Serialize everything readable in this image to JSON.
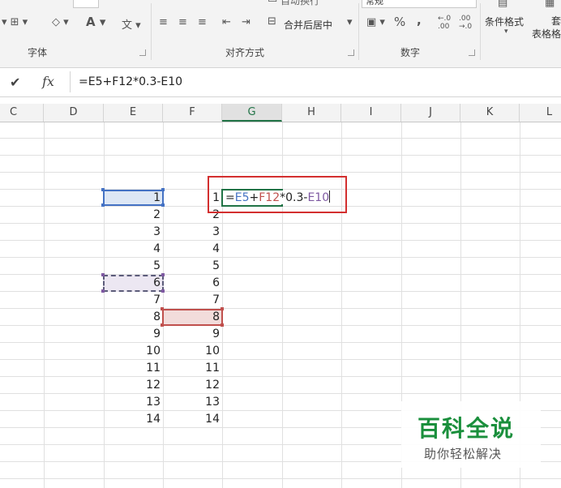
{
  "ribbon": {
    "font_group_label": "字体",
    "align_group_label": "对齐方式",
    "number_group_label": "数字",
    "merge_center_label": "合并后居中",
    "percent_symbol": "%",
    "comma_symbol": ",",
    "cond_format_label": "条件格式",
    "table_format_label": "套用\n表格格式",
    "wrap_text_label": "自动换行",
    "number_format_value": "常规",
    "increase_decimal_label": "←.0\n.00",
    "decrease_decimal_label": ".00\n→.0",
    "font_color_label": "A",
    "phonetic_label": "文"
  },
  "formula_bar": {
    "cancel_symbol": "✔",
    "fx_symbol": "fx",
    "formula": "=E5+F12*0.3-E10"
  },
  "columns": [
    "C",
    "D",
    "E",
    "F",
    "G",
    "H",
    "I",
    "J",
    "K",
    "L"
  ],
  "selected_column": "G",
  "cells_E": [
    "1",
    "2",
    "3",
    "4",
    "5",
    "6",
    "7",
    "8",
    "9",
    "10",
    "11",
    "12",
    "13",
    "14"
  ],
  "cells_F": [
    "1",
    "2",
    "3",
    "4",
    "5",
    "6",
    "7",
    "8",
    "9",
    "10",
    "11",
    "12",
    "13",
    "14"
  ],
  "edit_cell": {
    "eq": "=",
    "ref1": "E5",
    "op1": "+",
    "ref2": "F12",
    "rest": "*0.3-",
    "ref3": "E10"
  },
  "colors": {
    "ref_blue": "#4472c4",
    "ref_red": "#c0504d",
    "ref_purple": "#7f5aa2",
    "excel_green": "#217346",
    "highlight_red_box": "#d32f2f"
  },
  "watermark": {
    "title": "百科全说",
    "subtitle": "助你轻松解决"
  }
}
